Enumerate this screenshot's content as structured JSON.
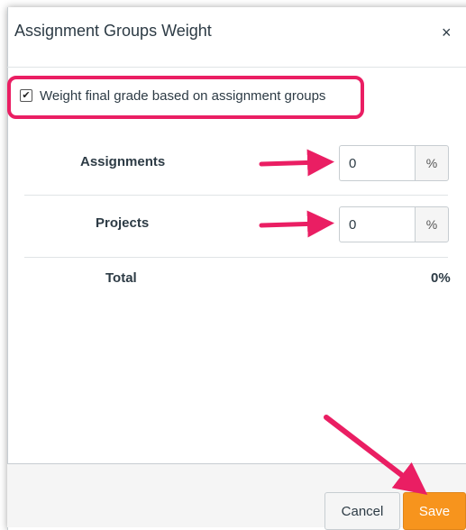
{
  "dialog": {
    "title": "Assignment Groups Weight",
    "close_glyph": "×"
  },
  "weight_option": {
    "checked": true,
    "check_glyph": "✔",
    "label": "Weight final grade based on assignment groups"
  },
  "groups": [
    {
      "label": "Assignments",
      "value": "0",
      "suffix": "%"
    },
    {
      "label": "Projects",
      "value": "0",
      "suffix": "%"
    }
  ],
  "total": {
    "label": "Total",
    "value": "0%"
  },
  "footer": {
    "cancel_label": "Cancel",
    "save_label": "Save"
  },
  "colors": {
    "highlight": "#ea1e63",
    "save_button": "#f7941d",
    "text": "#2d3b45"
  },
  "annotations": {
    "arrow_icon_names": [
      "arrow-right-icon",
      "arrow-right-icon",
      "arrow-down-right-icon"
    ]
  }
}
